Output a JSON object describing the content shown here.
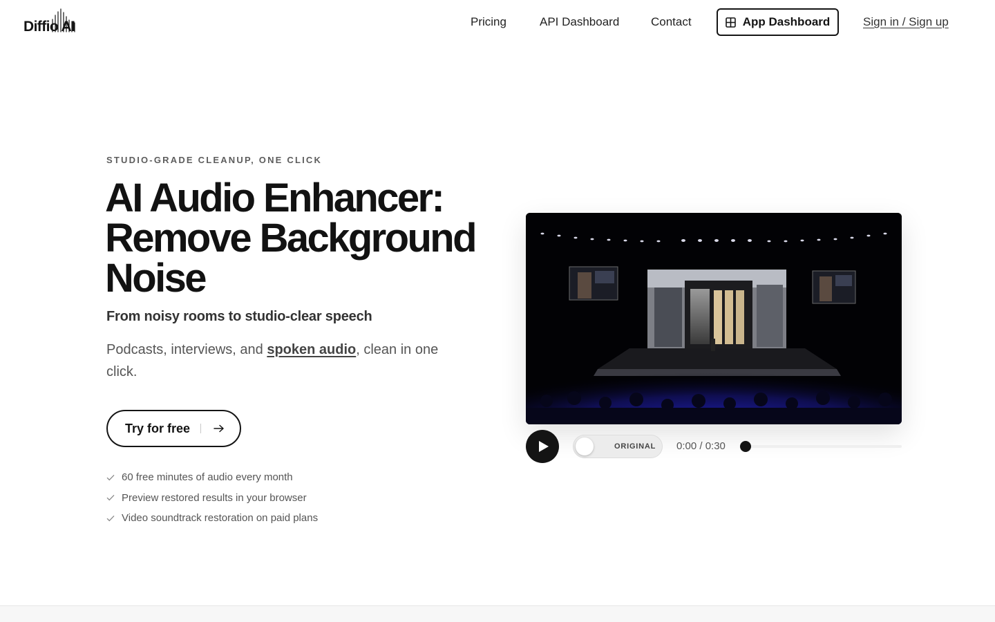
{
  "brand": {
    "logo_text": "Diffio AI"
  },
  "nav": {
    "links": [
      {
        "label": "Pricing"
      },
      {
        "label": "API Dashboard"
      },
      {
        "label": "Contact"
      }
    ],
    "app_dashboard_label": "App Dashboard",
    "app_dashboard_icon": "grid-icon",
    "signin_label": "Sign in / Sign up"
  },
  "hero": {
    "eyebrow": "STUDIO-GRADE CLEANUP, ONE CLICK",
    "title": "AI Audio Enhancer: Remove Background Noise",
    "subtitle": "From noisy rooms to studio-clear speech",
    "description": {
      "before": "Podcasts, interviews, and ",
      "link": "spoken audio",
      "after": ", clean in one click."
    },
    "cta_label": "Try for free",
    "cta_icon": "arrow-right-icon",
    "features": [
      {
        "text": "60 free minutes of audio every month"
      },
      {
        "text": "Preview restored results in your browser"
      },
      {
        "text": "Video soundtrack restoration on paid plans"
      }
    ]
  },
  "player": {
    "toggle_label": "ORIGINAL",
    "toggle_on": false,
    "time": "0:00 / 0:30",
    "progress": 0,
    "play_icon": "play-icon"
  },
  "colors": {
    "text": "#141414",
    "muted": "#555555",
    "stage_light": "#2a2cff"
  }
}
